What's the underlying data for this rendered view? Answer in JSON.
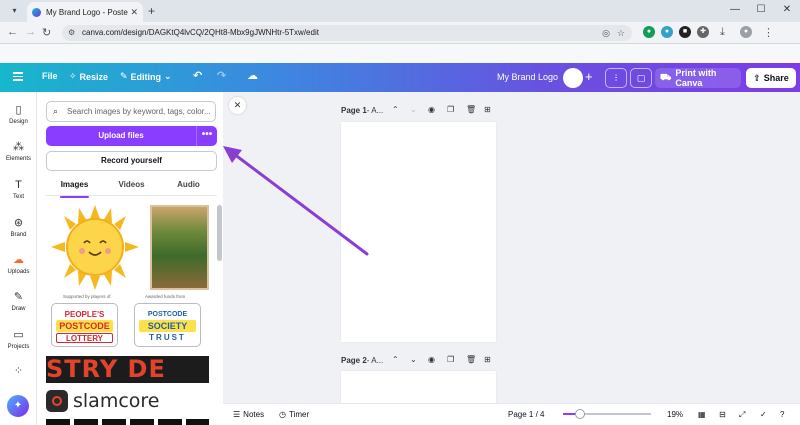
{
  "browser": {
    "tab_title": "My Brand Logo - Poster - Canva",
    "url": "canva.com/design/DAGKtQ4lvCQ/2QHt8-Mbx9gJWNHtr-5Txw/edit",
    "new_tab": "+",
    "window_controls": [
      "—",
      "☐",
      "✕"
    ]
  },
  "header": {
    "file": "File",
    "resize": "Resize",
    "editing": "Editing",
    "design_title": "My Brand Logo",
    "print_label": "Print with Canva",
    "share_label": "Share"
  },
  "rail": {
    "items": [
      {
        "label": "Design",
        "icon": "▯"
      },
      {
        "label": "Elements",
        "icon": "⁂"
      },
      {
        "label": "Text",
        "icon": "T"
      },
      {
        "label": "Brand",
        "icon": "⊛"
      },
      {
        "label": "Uploads",
        "icon": "☁"
      },
      {
        "label": "Draw",
        "icon": "✎"
      },
      {
        "label": "Projects",
        "icon": "▭"
      },
      {
        "label": "",
        "icon": "⁘"
      }
    ],
    "active": "Uploads"
  },
  "panel": {
    "search_placeholder": "Search images by keyword, tags, color...",
    "upload_label": "Upload files",
    "more_label": "•••",
    "record_label": "Record yourself",
    "tabs": [
      "Images",
      "Videos",
      "Audio"
    ],
    "active_tab": "Images",
    "caption_left": "Supported by players of",
    "caption_right": "Awarded funds from",
    "lottery1": [
      "PEOPLE'S",
      "POSTCODE",
      "LOTTERY"
    ],
    "lottery2": [
      "POSTCODE",
      "SOCIETY",
      "TRUST"
    ],
    "stryde_text": "STRY DE",
    "slam_text": "slamcore"
  },
  "canvas": {
    "page1_label": "Page 1",
    "page1_title": " - A...",
    "page2_label": "Page 2",
    "page2_title": " - A..."
  },
  "footer": {
    "notes": "Notes",
    "timer": "Timer",
    "page_indicator": "Page 1 / 4",
    "zoom": "19%",
    "zoom_fraction": 0.19
  },
  "colors": {
    "accent": "#8b3dff",
    "arrow": "#8a3fd1",
    "uploads_icon": "#ff6a2b"
  }
}
